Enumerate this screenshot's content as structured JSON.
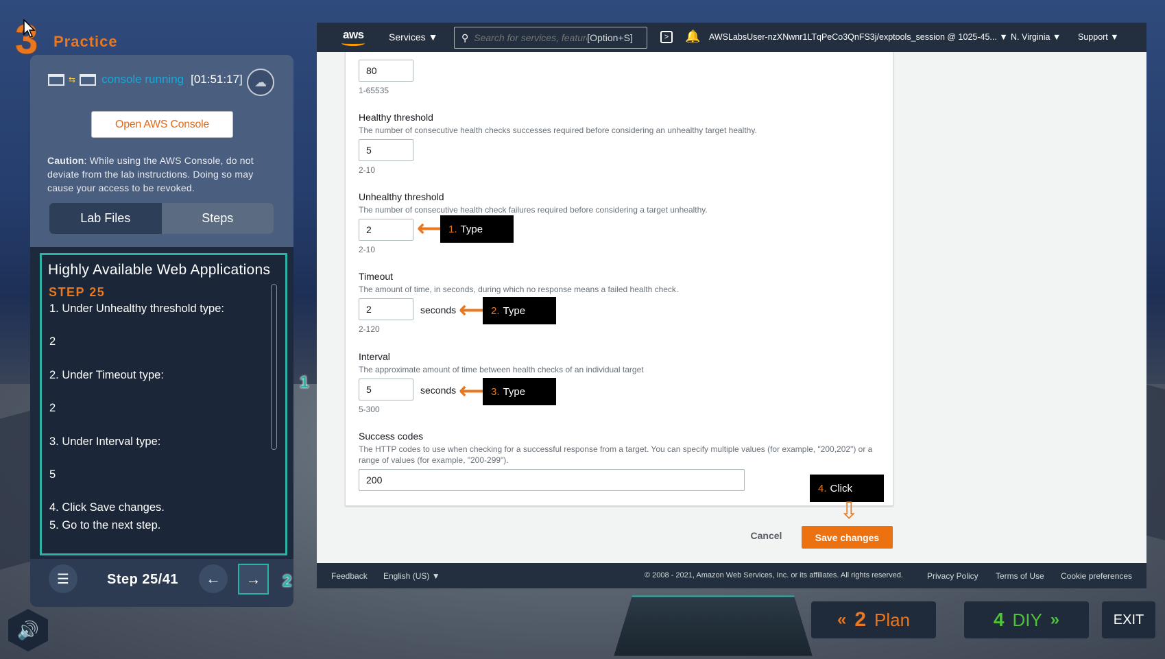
{
  "practice": {
    "number": "3",
    "title": "Practice"
  },
  "console": {
    "status": "console running",
    "timer": "[01:51:17]",
    "open_button": "Open AWS Console",
    "caution_label": "Caution",
    "caution_text": ": While using the AWS Console, do not deviate from the lab instructions. Doing so may cause your access to be revoked."
  },
  "tabs": [
    {
      "label": "Lab Files"
    },
    {
      "label": "Steps"
    }
  ],
  "steps": {
    "title": "Highly Available Web Applications",
    "step_label": "STEP 25",
    "lines": [
      "1. Under Unhealthy threshold type:",
      "2",
      "2. Under Timeout type:",
      "2",
      "3. Under Interval type:",
      "5",
      "4. Click Save changes.",
      "5. Go to the next step."
    ],
    "counter": "Step 25/41"
  },
  "markers": {
    "one": "1",
    "two": "2"
  },
  "aws": {
    "logo": "aws",
    "services": "Services",
    "search_placeholder": "Search for services, features",
    "search_shortcut": "[Option+S]",
    "user": "AWSLabsUser-nzXNwnr1LTqPeCo3QnFS3j/exptools_session @ 1025-45...",
    "region": "N. Virginia",
    "support": "Support"
  },
  "form": {
    "port_value": "80",
    "port_hint": "1-65535",
    "healthy": {
      "label": "Healthy threshold",
      "desc": "The number of consecutive health checks successes required before considering an unhealthy target healthy.",
      "value": "5",
      "hint": "2-10"
    },
    "unhealthy": {
      "label": "Unhealthy threshold",
      "desc": "The number of consecutive health check failures required before considering a target unhealthy.",
      "value": "2",
      "hint": "2-10"
    },
    "timeout": {
      "label": "Timeout",
      "desc": "The amount of time, in seconds, during which no response means a failed health check.",
      "value": "2",
      "unit": "seconds",
      "hint": "2-120"
    },
    "interval": {
      "label": "Interval",
      "desc": "The approximate amount of time between health checks of an individual target",
      "value": "5",
      "unit": "seconds",
      "hint": "5-300"
    },
    "success": {
      "label": "Success codes",
      "desc1": "The HTTP codes to use when checking for a successful response from a target. You can specify multiple values (for example, \"200,202\") or a",
      "desc2": "range of values (for example, \"200-299\").",
      "value": "200"
    },
    "cancel": "Cancel",
    "save": "Save changes"
  },
  "callouts": [
    {
      "num": "1.",
      "text": "Type"
    },
    {
      "num": "2.",
      "text": "Type"
    },
    {
      "num": "3.",
      "text": "Type"
    },
    {
      "num": "4.",
      "text": "Click"
    }
  ],
  "footer": {
    "feedback": "Feedback",
    "language": "English (US)",
    "copyright": "© 2008 - 2021, Amazon Web Services, Inc. or its affiliates. All rights reserved.",
    "privacy": "Privacy Policy",
    "terms": "Terms of Use",
    "cookies": "Cookie preferences"
  },
  "bottom_nav": {
    "plan_num": "2",
    "plan_label": "Plan",
    "diy_num": "4",
    "diy_label": "DIY",
    "exit": "EXIT"
  }
}
